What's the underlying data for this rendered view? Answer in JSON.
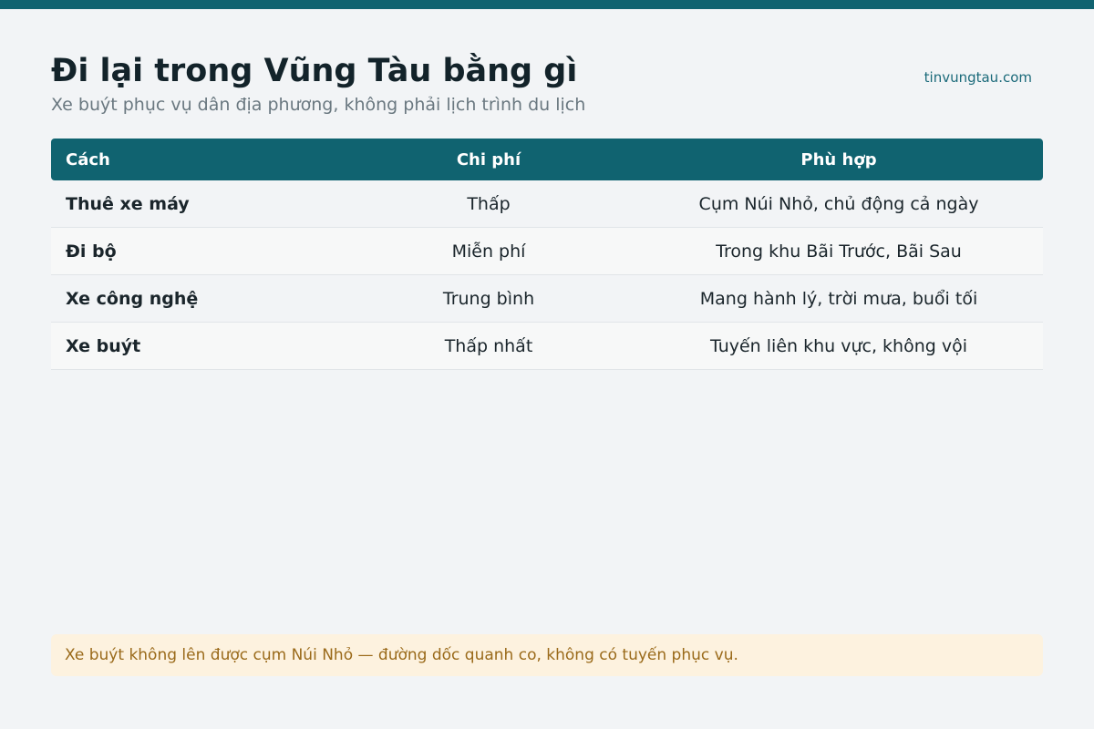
{
  "header": {
    "title": "Đi lại trong Vũng Tàu bằng gì",
    "subtitle": "Xe buýt phục vụ dân địa phương, không phải lịch trình du lịch",
    "site": "tinvungtau.com"
  },
  "table": {
    "columns": [
      "Cách",
      "Chi phí",
      "Phù hợp"
    ],
    "rows": [
      [
        "Thuê xe máy",
        "Thấp",
        "Cụm Núi Nhỏ, chủ động cả ngày"
      ],
      [
        "Đi bộ",
        "Miễn phí",
        "Trong khu Bãi Trước, Bãi Sau"
      ],
      [
        "Xe công nghệ",
        "Trung bình",
        "Mang hành lý, trời mưa, buổi tối"
      ],
      [
        "Xe buýt",
        "Thấp nhất",
        "Tuyến liên khu vực, không vội"
      ]
    ]
  },
  "note": "Xe buýt không lên được cụm Núi Nhỏ — đường dốc quanh co, không có tuyến phục vụ.",
  "colors": {
    "accent": "#106370",
    "note_bg": "#fdf2df",
    "note_text": "#9a6a1a"
  }
}
